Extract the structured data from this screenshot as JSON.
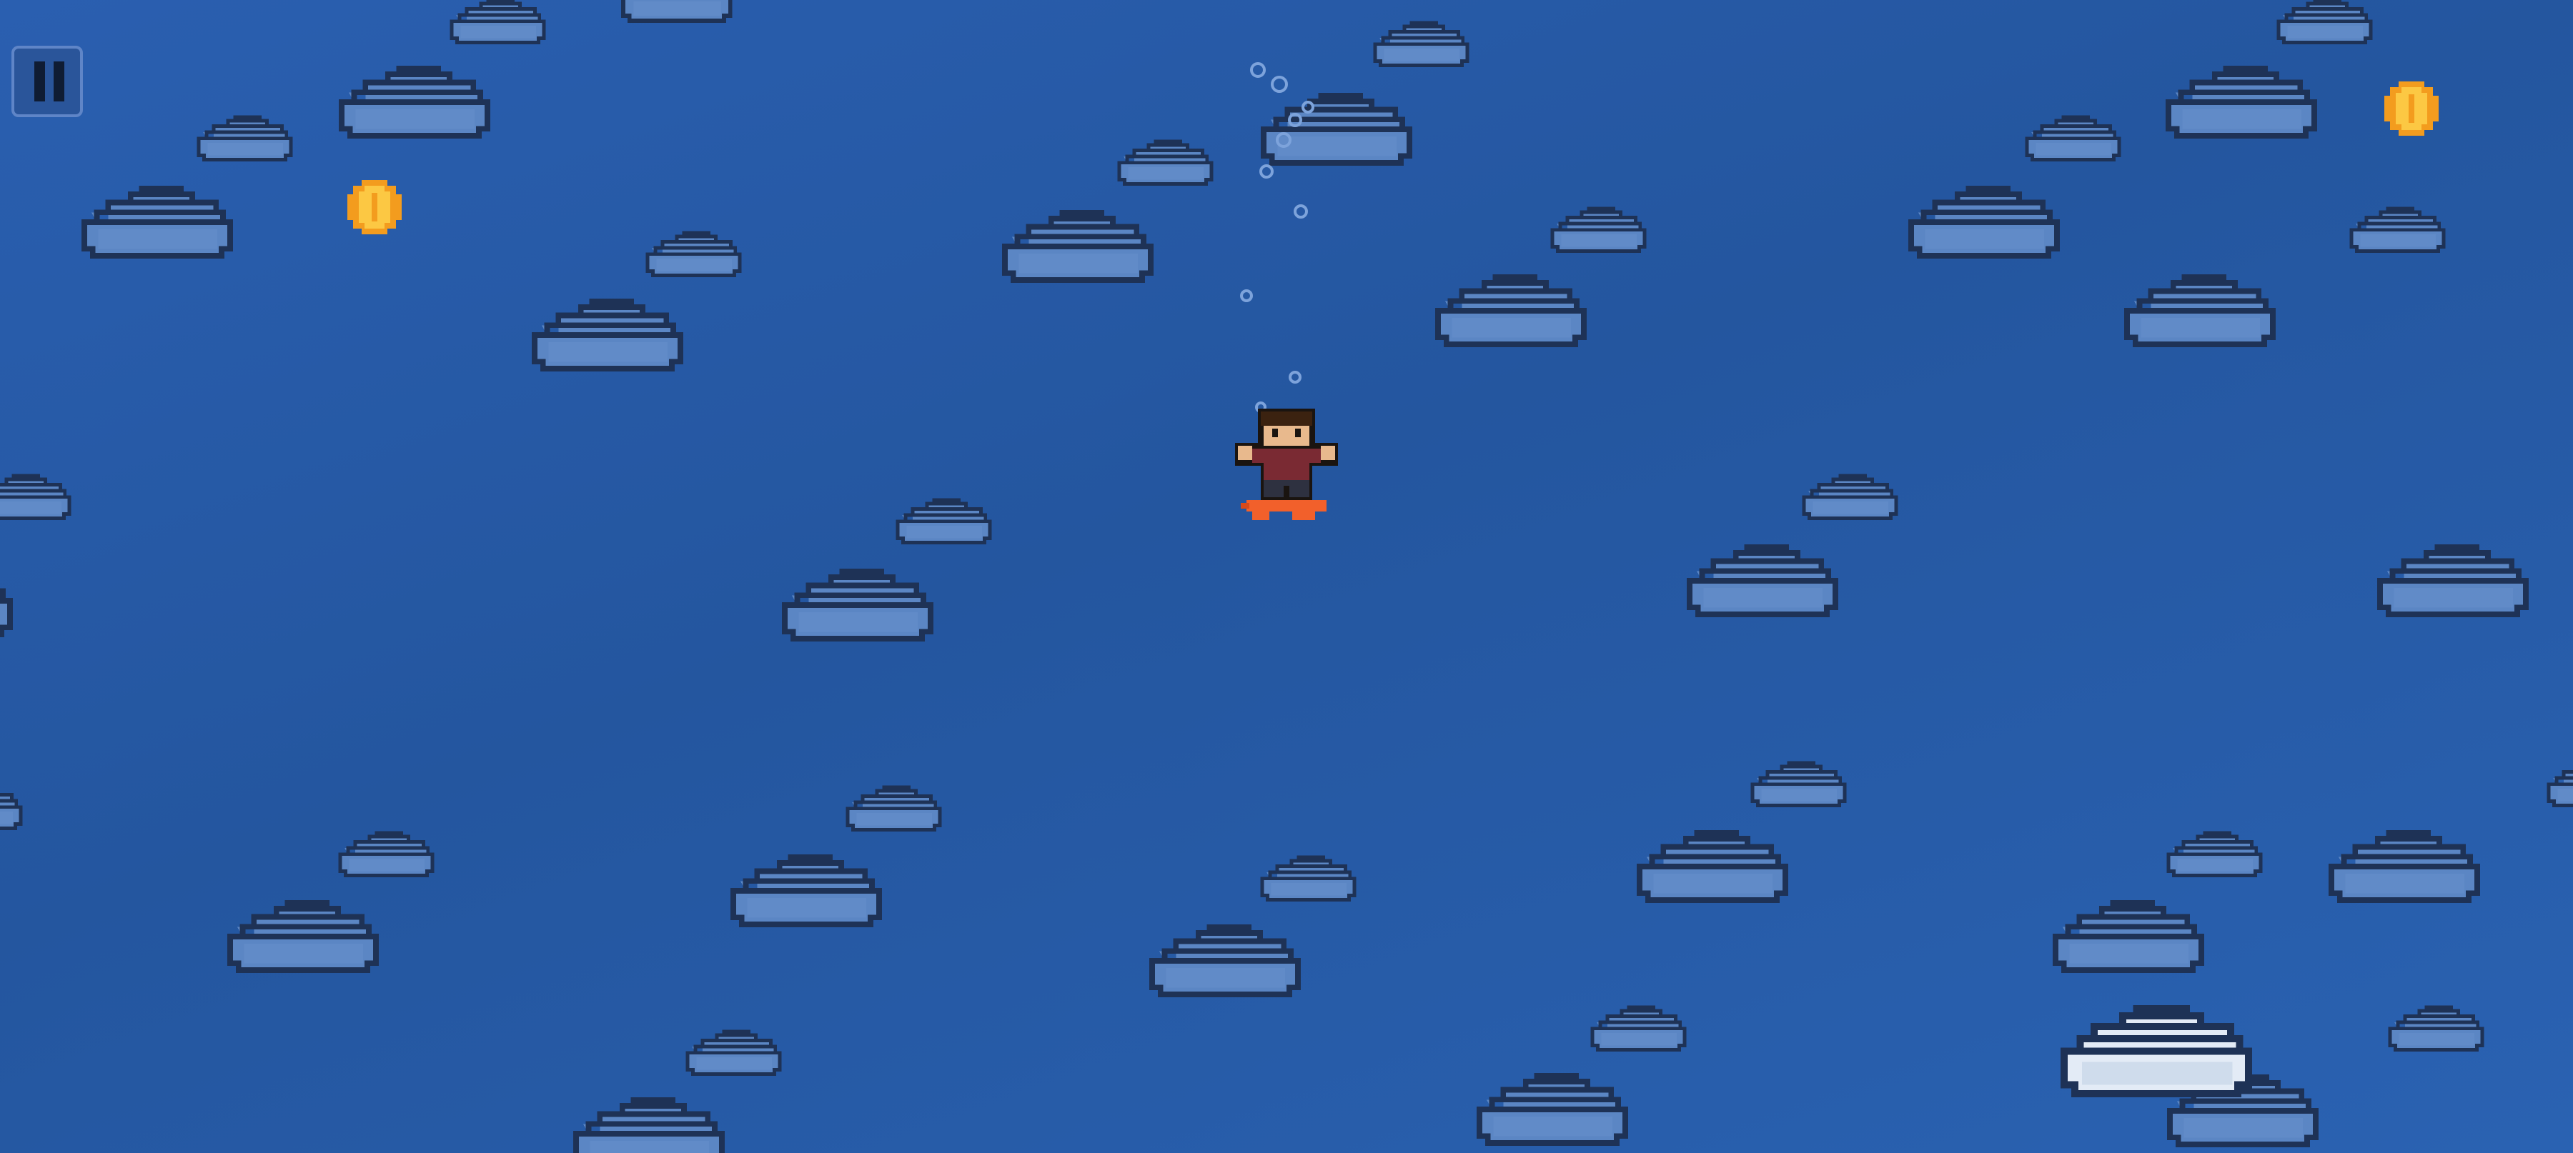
{
  "hud": {
    "pause_button": {
      "label": "Pause",
      "icon": "pause-icon"
    }
  },
  "scene": {
    "sky_color": "#2a5fb0",
    "cloud_color": "#5b86c4",
    "cloud_outline_color": "#1e3256",
    "landing_cloud_color": "#e3ebf6",
    "coin_color": "#f6b531"
  },
  "player": {
    "hair_color": "#3b2210",
    "shirt_color": "#7a2a33",
    "skin_color": "#e8b98d",
    "board_color": "#f2602b"
  }
}
